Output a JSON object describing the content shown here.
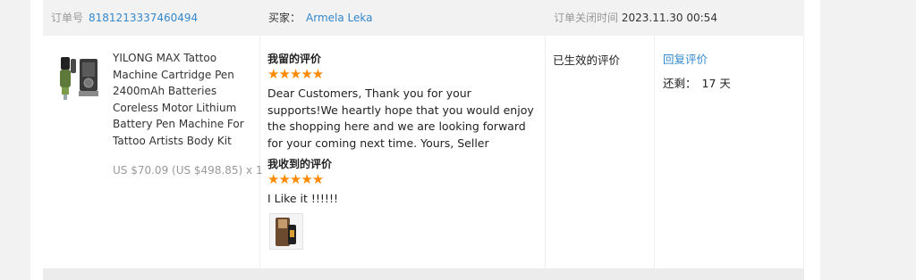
{
  "header": {
    "order_label": "订单号",
    "order_number": "8181213337460494",
    "buyer_label": "买家：",
    "buyer_name": "Armela Leka",
    "closed_label": "订单关闭时间",
    "closed_time": "2023.11.30 00:54"
  },
  "product": {
    "title": "YILONG MAX Tattoo Machine Cartridge Pen 2400mAh Batteries Coreless Motor Lithium Battery Pen Machine For Tattoo Artists Body Kit",
    "price": "US $70.09 (US $498.85) x 1",
    "image_icon": "tattoo-pen-image"
  },
  "my_review": {
    "title": "我留的评价",
    "stars": "★★★★★",
    "rating": 5,
    "text": "Dear Customers, Thank you for your supports!We heartly hope that you would enjoy the shopping here and we are looking forward for your coming next time. Yours, Seller"
  },
  "received_review": {
    "title": "我收到的评价",
    "stars": "★★★★★",
    "rating": 5,
    "text": "I Like it !!!!!!",
    "photo_icon": "review-photo"
  },
  "status": {
    "label": "已生效的评价"
  },
  "actions": {
    "reply_label": "回复评价",
    "remaining_label": "还剩：",
    "remaining_value": "17 天"
  },
  "colors": {
    "link": "#3388cc",
    "star": "#ff8a00",
    "header_bg": "#f2f2f2"
  }
}
